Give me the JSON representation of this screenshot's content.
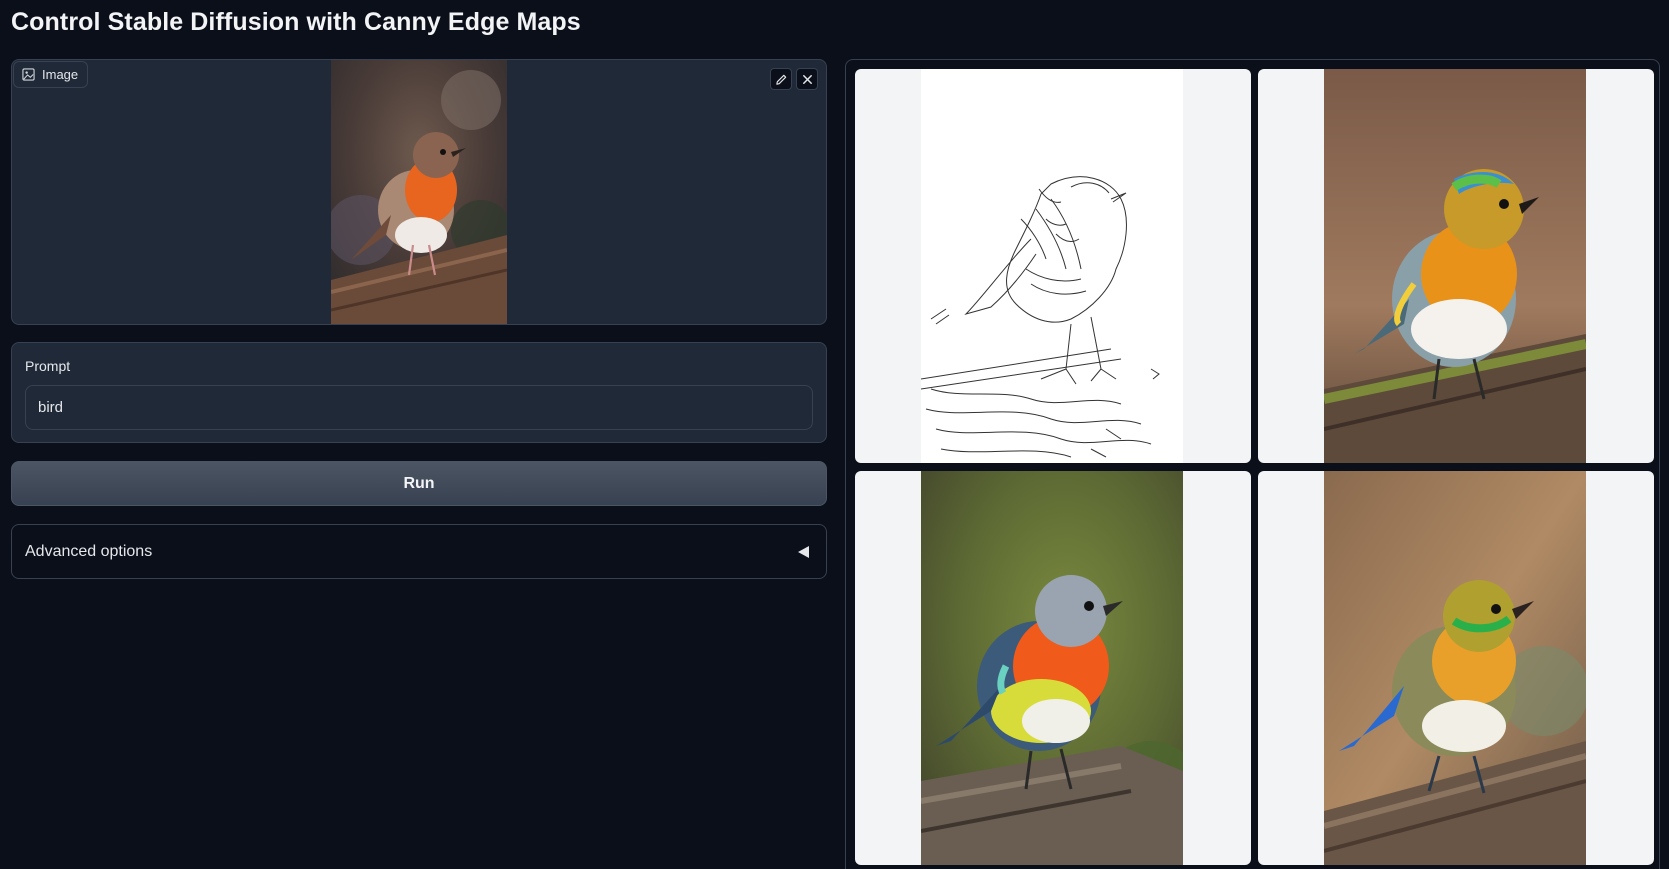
{
  "page": {
    "title": "Control Stable Diffusion with Canny Edge Maps"
  },
  "image_input": {
    "label": "Image",
    "label_icon": "image-icon",
    "edit_icon": "pencil-icon",
    "close_icon": "close-icon"
  },
  "prompt": {
    "label": "Prompt",
    "value": "bird"
  },
  "run_button": {
    "label": "Run"
  },
  "advanced": {
    "label": "Advanced options",
    "icon": "triangle-left-icon"
  },
  "gallery": {
    "items": [
      {
        "kind": "canny-edge-map"
      },
      {
        "kind": "generated-bird"
      },
      {
        "kind": "generated-bird"
      },
      {
        "kind": "generated-bird"
      }
    ]
  },
  "colors": {
    "background": "#0b0f19",
    "panel": "#1f2937",
    "border": "#374151",
    "button": "#4b5563",
    "thumb_bg": "#f3f4f6"
  }
}
